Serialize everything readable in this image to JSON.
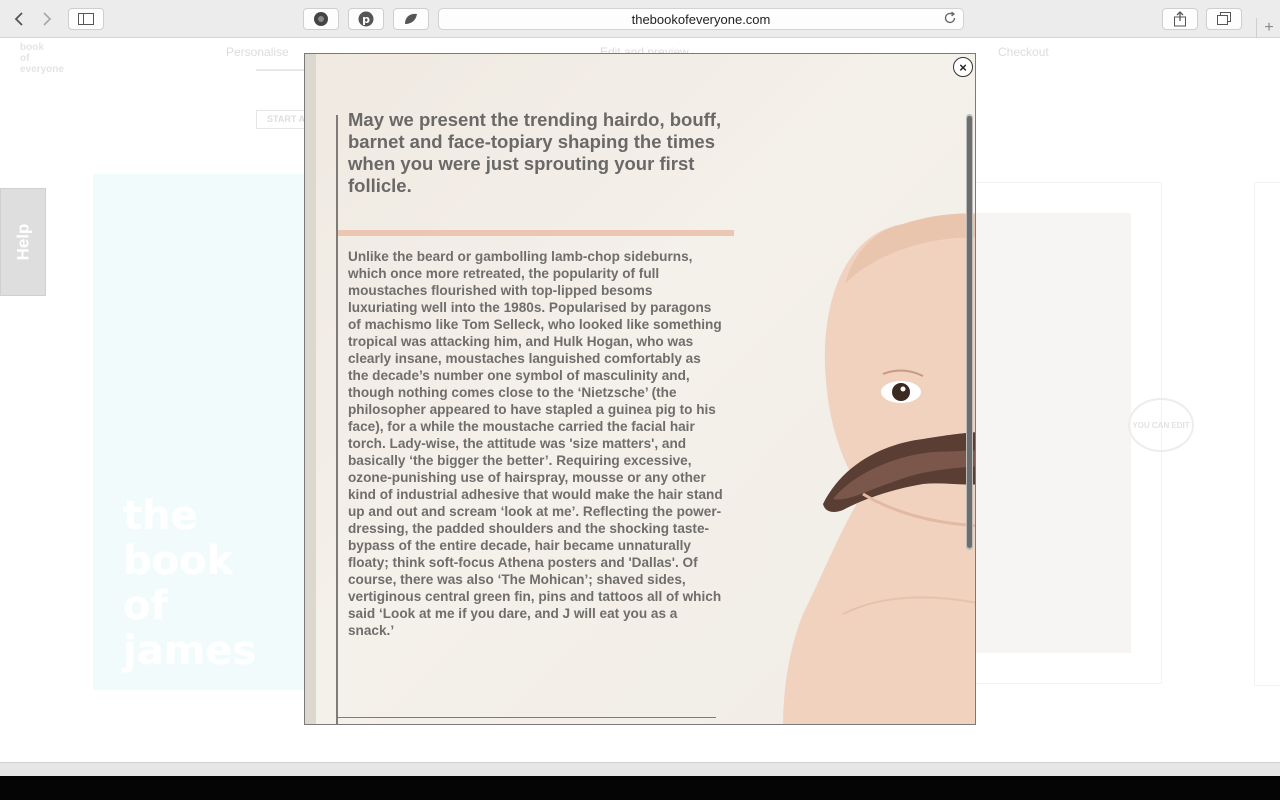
{
  "browser": {
    "url": "thebookofeveryone.com",
    "new_tab_label": "+"
  },
  "page_behind": {
    "logo_lines": [
      "book",
      "of",
      "everyone"
    ],
    "nav": {
      "personalise": "Personalise",
      "edit_preview": "Edit and preview",
      "checkout": "Checkout"
    },
    "start_again_label": "START AGAIN",
    "help_label": "Help",
    "cover_title_lines": [
      "the",
      "book",
      "of",
      "james"
    ],
    "edit_badge_label": "YOU CAN EDIT"
  },
  "modal": {
    "close_label": "×",
    "headline": "May we present the trending hairdo, bouff, barnet and face-topiary shaping the times when you were just sprouting your first follicle.",
    "body": "Unlike the beard or gambolling lamb-chop sideburns, which once more retreated, the popularity of full moustaches flourished with top-lipped besoms luxuriating well into the 1980s. Popularised by paragons of machismo like Tom Selleck, who looked like something tropical was attacking him, and Hulk Hogan, who was clearly insane, moustaches languished comfortably as the decade’s number one symbol of masculinity and, though nothing comes close to the ‘Nietzsche’ (the philosopher appeared to have stapled a guinea pig to his face), for a while the moustache carried the facial hair torch. Lady-wise, the attitude was 'size matters', and basically ‘the bigger the better’. Requiring excessive, ozone-punishing use of hairspray, mousse or any other kind of industrial adhesive that would make the hair stand up and out and scream ‘look at me’. Reflecting the power-dressing, the padded shoulders and the shocking taste-bypass of the entire decade, hair became unnaturally floaty; think soft-focus Athena posters and 'Dallas'. Of course, there was also ‘The Mohican’; shaved sides, vertiginous central green fin, pins and tattoos all of which said ‘Look at me if you dare, and J will eat you as a snack.’"
  },
  "colors": {
    "headline": "#6a6967",
    "orange_rule": "#edc6b3",
    "modal_bg": "#f1ece6"
  }
}
